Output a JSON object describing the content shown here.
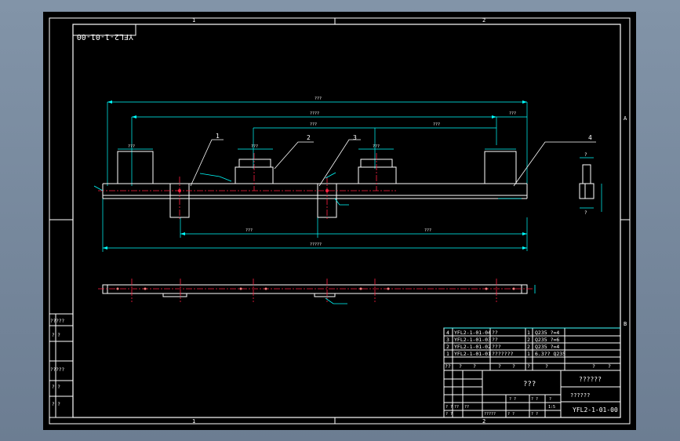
{
  "drawing": {
    "title_mirrored": "YFL2-1-01-00",
    "zone_numbers": {
      "col1": "1",
      "col2": "2",
      "rowA": "A",
      "rowB": "B"
    },
    "dimensions": {
      "overall_length": "???",
      "span_upper": "????",
      "seg1": "???",
      "seg2": "???",
      "right_end": "???",
      "left_lower": "???",
      "right_lower": "???",
      "bottom_total": "?????",
      "small_left": "???",
      "small_mid": "???",
      "small_right": "???"
    },
    "balloons": [
      "1",
      "2",
      "3",
      "4"
    ],
    "side_block_labels": [
      "?",
      "?"
    ]
  },
  "left_margin": {
    "labels": [
      "?????",
      "?  ?",
      "?????",
      "?  ?",
      "?  ?"
    ]
  },
  "parts_list": {
    "rows": [
      {
        "no": "4",
        "code": "YFL2-1-01-04",
        "name": "??",
        "qty": "1",
        "material": "Q235  ?=4"
      },
      {
        "no": "3",
        "code": "YFL2-1-01-03",
        "name": "??",
        "qty": "2",
        "material": "Q235  ?=6"
      },
      {
        "no": "2",
        "code": "YFL2-1-01-02",
        "name": "???",
        "qty": "2",
        "material": "Q235  ?=4"
      },
      {
        "no": "1",
        "code": "YFL2-1-01-01",
        "name": "???????",
        "qty": "1",
        "material": "6.3??  Q235"
      }
    ],
    "header": [
      "??",
      "?",
      "?",
      "?",
      "?",
      "?",
      "?",
      "?",
      "?"
    ]
  },
  "title_block": {
    "part_name": "???",
    "company": "??????",
    "sub_company": "??????",
    "drawing_number": "YFL2-1-01-00",
    "scale_cells": [
      "? ?",
      "? ?",
      "?"
    ],
    "small_cells": [
      "? ?",
      "??",
      "??",
      "? ?",
      "?????",
      "? ?",
      "? ?",
      "1:5"
    ]
  }
}
